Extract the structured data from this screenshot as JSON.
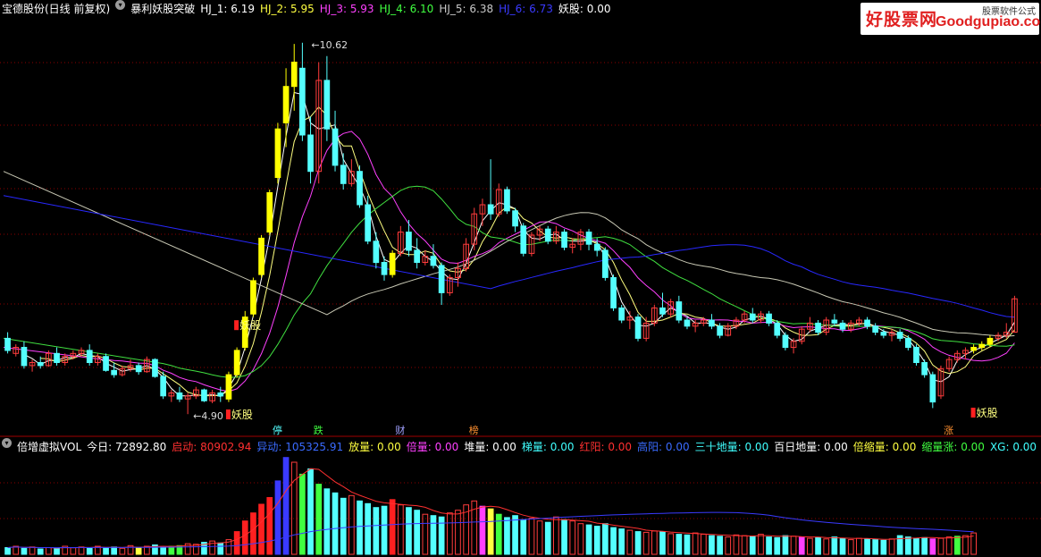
{
  "header_top": {
    "stock": "宝德股份(日线 前复权)",
    "indicator": "暴利妖股突破",
    "hj": [
      {
        "label": "HJ_1: 6.19",
        "color": "#ffffff"
      },
      {
        "label": "HJ_2: 5.95",
        "color": "#ffff40"
      },
      {
        "label": "HJ_3: 5.93",
        "color": "#ff40ff"
      },
      {
        "label": "HJ_4: 6.10",
        "color": "#40ff40"
      },
      {
        "label": "HJ_5: 6.38",
        "color": "#c8c8c8"
      },
      {
        "label": "HJ_6: 6.73",
        "color": "#3a3aff"
      }
    ],
    "yaogu": "妖股: 0.00"
  },
  "header_bottom": {
    "name": "倍增虚拟VOL",
    "items": [
      {
        "label": "今日: 72892.80",
        "color": "#ffffff"
      },
      {
        "label": "启动: 80902.94",
        "color": "#ff3030"
      },
      {
        "label": "异动: 105325.91",
        "color": "#3a6bff"
      },
      {
        "label": "放量: 0.00",
        "color": "#ffff40"
      },
      {
        "label": "倍量: 0.00",
        "color": "#ff40ff"
      },
      {
        "label": "堆量: 0.00",
        "color": "#ffffff"
      },
      {
        "label": "梯量: 0.00",
        "color": "#40ffff"
      },
      {
        "label": "红阳: 0.00",
        "color": "#ff3030"
      },
      {
        "label": "高阳: 0.00",
        "color": "#3a6bff"
      },
      {
        "label": "三十地量: 0.00",
        "color": "#40ffff"
      },
      {
        "label": "百日地量: 0.00",
        "color": "#ffffff"
      },
      {
        "label": "倍缩量: 0.00",
        "color": "#ffff40"
      },
      {
        "label": "缩量涨: 0.00",
        "color": "#40ff40"
      },
      {
        "label": "XG: 0.00",
        "color": "#40ffff"
      }
    ]
  },
  "logo": {
    "brand": "好股票网",
    "domain": "Goodgupiao.com",
    "tag": "股票软件公式"
  },
  "colors": {
    "up": "#ff3c3c",
    "down": "#54ffff",
    "signal": "#ffff00",
    "ma_white": "#ffffff",
    "ma_yellow": "#ffff80",
    "ma_magenta": "#ff40ff",
    "ma_green": "#40e040",
    "ma_gray": "#c8c8b4",
    "ma_blue": "#2828ff",
    "grid": "#8b0000"
  },
  "chart_data": {
    "type": "candlestick",
    "price_range": [
      4.4,
      11.0
    ],
    "bars": [
      {
        "o": 5.75,
        "h": 5.85,
        "l": 5.5,
        "c": 5.55
      },
      {
        "o": 5.5,
        "h": 5.65,
        "l": 5.45,
        "c": 5.6
      },
      {
        "o": 5.6,
        "h": 5.7,
        "l": 5.25,
        "c": 5.3
      },
      {
        "o": 5.3,
        "h": 5.4,
        "l": 5.2,
        "c": 5.35
      },
      {
        "o": 5.35,
        "h": 5.45,
        "l": 5.25,
        "c": 5.3
      },
      {
        "o": 5.3,
        "h": 5.55,
        "l": 5.28,
        "c": 5.5
      },
      {
        "o": 5.5,
        "h": 5.6,
        "l": 5.3,
        "c": 5.35
      },
      {
        "o": 5.35,
        "h": 5.5,
        "l": 5.3,
        "c": 5.45
      },
      {
        "o": 5.45,
        "h": 5.55,
        "l": 5.4,
        "c": 5.5
      },
      {
        "o": 5.5,
        "h": 5.6,
        "l": 5.45,
        "c": 5.55
      },
      {
        "o": 5.55,
        "h": 5.65,
        "l": 5.3,
        "c": 5.35
      },
      {
        "o": 5.35,
        "h": 5.5,
        "l": 5.3,
        "c": 5.45
      },
      {
        "o": 5.45,
        "h": 5.5,
        "l": 5.2,
        "c": 5.22
      },
      {
        "o": 5.22,
        "h": 5.35,
        "l": 5.1,
        "c": 5.15
      },
      {
        "o": 5.15,
        "h": 5.3,
        "l": 5.12,
        "c": 5.25
      },
      {
        "o": 5.25,
        "h": 5.4,
        "l": 5.2,
        "c": 5.3
      },
      {
        "o": 5.3,
        "h": 5.35,
        "l": 5.15,
        "c": 5.2
      },
      {
        "o": 5.2,
        "h": 5.45,
        "l": 5.18,
        "c": 5.4
      },
      {
        "o": 5.4,
        "h": 5.42,
        "l": 5.1,
        "c": 5.12
      },
      {
        "o": 5.12,
        "h": 5.2,
        "l": 4.75,
        "c": 4.8
      },
      {
        "o": 4.8,
        "h": 4.9,
        "l": 4.7,
        "c": 4.85
      },
      {
        "o": 4.85,
        "h": 4.95,
        "l": 4.7,
        "c": 4.75
      },
      {
        "o": 4.75,
        "h": 4.85,
        "l": 4.5,
        "c": 4.8
      },
      {
        "o": 4.8,
        "h": 4.95,
        "l": 4.75,
        "c": 4.9
      },
      {
        "o": 4.9,
        "h": 4.92,
        "l": 4.7,
        "c": 4.72
      },
      {
        "o": 4.72,
        "h": 4.9,
        "l": 4.68,
        "c": 4.85
      },
      {
        "o": 4.85,
        "h": 4.95,
        "l": 4.7,
        "c": 4.8
      },
      {
        "o": 4.75,
        "h": 5.2,
        "l": 4.7,
        "c": 5.15
      },
      {
        "o": 5.15,
        "h": 5.6,
        "l": 5.1,
        "c": 5.55
      },
      {
        "o": 5.6,
        "h": 6.2,
        "l": 5.55,
        "c": 6.1
      },
      {
        "o": 6.15,
        "h": 6.75,
        "l": 6.1,
        "c": 6.7
      },
      {
        "o": 6.8,
        "h": 7.45,
        "l": 6.75,
        "c": 7.4
      },
      {
        "o": 7.5,
        "h": 8.2,
        "l": 7.45,
        "c": 8.15
      },
      {
        "o": 8.4,
        "h": 9.3,
        "l": 8.3,
        "c": 9.2
      },
      {
        "o": 9.3,
        "h": 10.2,
        "l": 8.9,
        "c": 9.9
      },
      {
        "o": 9.9,
        "h": 10.6,
        "l": 9.5,
        "c": 10.3
      },
      {
        "o": 10.2,
        "h": 10.62,
        "l": 9.0,
        "c": 9.1
      },
      {
        "o": 9.1,
        "h": 9.4,
        "l": 8.3,
        "c": 8.5
      },
      {
        "o": 8.5,
        "h": 10.3,
        "l": 8.3,
        "c": 10.0
      },
      {
        "o": 10.0,
        "h": 10.4,
        "l": 9.0,
        "c": 9.2
      },
      {
        "o": 9.2,
        "h": 9.5,
        "l": 8.5,
        "c": 8.6
      },
      {
        "o": 8.6,
        "h": 8.8,
        "l": 8.2,
        "c": 8.3
      },
      {
        "o": 8.3,
        "h": 8.7,
        "l": 8.25,
        "c": 8.5
      },
      {
        "o": 8.5,
        "h": 8.6,
        "l": 7.9,
        "c": 7.95
      },
      {
        "o": 7.95,
        "h": 8.1,
        "l": 7.3,
        "c": 7.35
      },
      {
        "o": 7.35,
        "h": 7.5,
        "l": 6.9,
        "c": 7.0
      },
      {
        "o": 7.0,
        "h": 7.1,
        "l": 6.7,
        "c": 6.8
      },
      {
        "o": 6.8,
        "h": 7.2,
        "l": 6.75,
        "c": 7.15
      },
      {
        "o": 7.15,
        "h": 7.6,
        "l": 7.1,
        "c": 7.5
      },
      {
        "o": 7.5,
        "h": 7.7,
        "l": 7.1,
        "c": 7.2
      },
      {
        "o": 7.2,
        "h": 7.4,
        "l": 6.9,
        "c": 7.0
      },
      {
        "o": 7.0,
        "h": 7.2,
        "l": 6.95,
        "c": 7.1
      },
      {
        "o": 7.1,
        "h": 7.3,
        "l": 6.9,
        "c": 6.95
      },
      {
        "o": 6.95,
        "h": 7.0,
        "l": 6.3,
        "c": 6.5
      },
      {
        "o": 6.5,
        "h": 6.8,
        "l": 6.45,
        "c": 6.75
      },
      {
        "o": 6.75,
        "h": 7.0,
        "l": 6.6,
        "c": 6.9
      },
      {
        "o": 6.9,
        "h": 7.4,
        "l": 6.85,
        "c": 7.3
      },
      {
        "o": 7.3,
        "h": 7.9,
        "l": 7.2,
        "c": 7.8
      },
      {
        "o": 7.8,
        "h": 8.05,
        "l": 7.6,
        "c": 7.95
      },
      {
        "o": 7.95,
        "h": 8.7,
        "l": 7.7,
        "c": 7.8
      },
      {
        "o": 7.8,
        "h": 8.3,
        "l": 7.75,
        "c": 8.2
      },
      {
        "o": 8.2,
        "h": 8.25,
        "l": 7.8,
        "c": 7.85
      },
      {
        "o": 7.85,
        "h": 7.9,
        "l": 7.5,
        "c": 7.6
      },
      {
        "o": 7.6,
        "h": 7.65,
        "l": 7.1,
        "c": 7.15
      },
      {
        "o": 7.15,
        "h": 7.5,
        "l": 7.1,
        "c": 7.45
      },
      {
        "o": 7.45,
        "h": 7.6,
        "l": 7.35,
        "c": 7.55
      },
      {
        "o": 7.55,
        "h": 7.6,
        "l": 7.3,
        "c": 7.35
      },
      {
        "o": 7.35,
        "h": 7.6,
        "l": 7.3,
        "c": 7.5
      },
      {
        "o": 7.5,
        "h": 7.55,
        "l": 7.2,
        "c": 7.25
      },
      {
        "o": 7.25,
        "h": 7.4,
        "l": 7.15,
        "c": 7.3
      },
      {
        "o": 7.3,
        "h": 7.55,
        "l": 7.2,
        "c": 7.5
      },
      {
        "o": 7.5,
        "h": 7.55,
        "l": 7.2,
        "c": 7.3
      },
      {
        "o": 7.3,
        "h": 7.4,
        "l": 7.1,
        "c": 7.2
      },
      {
        "o": 7.2,
        "h": 7.25,
        "l": 6.7,
        "c": 6.75
      },
      {
        "o": 6.75,
        "h": 6.8,
        "l": 6.2,
        "c": 6.25
      },
      {
        "o": 6.25,
        "h": 6.3,
        "l": 6.0,
        "c": 6.05
      },
      {
        "o": 6.05,
        "h": 6.2,
        "l": 5.9,
        "c": 6.1
      },
      {
        "o": 6.1,
        "h": 6.15,
        "l": 5.7,
        "c": 5.75
      },
      {
        "o": 5.75,
        "h": 6.1,
        "l": 5.7,
        "c": 6.0
      },
      {
        "o": 6.0,
        "h": 6.3,
        "l": 5.95,
        "c": 6.25
      },
      {
        "o": 6.25,
        "h": 6.5,
        "l": 6.1,
        "c": 6.15
      },
      {
        "o": 6.15,
        "h": 6.4,
        "l": 6.1,
        "c": 6.35
      },
      {
        "o": 6.35,
        "h": 6.45,
        "l": 6.0,
        "c": 6.05
      },
      {
        "o": 6.05,
        "h": 6.1,
        "l": 5.9,
        "c": 5.95
      },
      {
        "o": 5.95,
        "h": 6.05,
        "l": 5.85,
        "c": 6.0
      },
      {
        "o": 6.0,
        "h": 6.1,
        "l": 5.95,
        "c": 6.05
      },
      {
        "o": 6.05,
        "h": 6.15,
        "l": 5.9,
        "c": 5.95
      },
      {
        "o": 5.95,
        "h": 6.0,
        "l": 5.75,
        "c": 5.8
      },
      {
        "o": 5.8,
        "h": 6.0,
        "l": 5.78,
        "c": 5.95
      },
      {
        "o": 5.95,
        "h": 6.1,
        "l": 5.9,
        "c": 6.05
      },
      {
        "o": 6.05,
        "h": 6.2,
        "l": 6.0,
        "c": 6.15
      },
      {
        "o": 6.15,
        "h": 6.25,
        "l": 6.0,
        "c": 6.05
      },
      {
        "o": 6.05,
        "h": 6.2,
        "l": 6.0,
        "c": 6.15
      },
      {
        "o": 6.15,
        "h": 6.2,
        "l": 5.95,
        "c": 6.0
      },
      {
        "o": 6.0,
        "h": 6.05,
        "l": 5.75,
        "c": 5.8
      },
      {
        "o": 5.8,
        "h": 5.85,
        "l": 5.55,
        "c": 5.6
      },
      {
        "o": 5.6,
        "h": 5.75,
        "l": 5.5,
        "c": 5.7
      },
      {
        "o": 5.7,
        "h": 5.95,
        "l": 5.65,
        "c": 5.9
      },
      {
        "o": 5.9,
        "h": 6.1,
        "l": 5.85,
        "c": 6.0
      },
      {
        "o": 6.0,
        "h": 6.05,
        "l": 5.8,
        "c": 5.85
      },
      {
        "o": 5.85,
        "h": 6.1,
        "l": 5.8,
        "c": 6.05
      },
      {
        "o": 6.05,
        "h": 6.15,
        "l": 5.95,
        "c": 6.0
      },
      {
        "o": 6.0,
        "h": 6.05,
        "l": 5.85,
        "c": 5.9
      },
      {
        "o": 5.9,
        "h": 6.05,
        "l": 5.85,
        "c": 6.0
      },
      {
        "o": 6.0,
        "h": 6.1,
        "l": 5.95,
        "c": 6.05
      },
      {
        "o": 6.05,
        "h": 6.1,
        "l": 5.9,
        "c": 5.95
      },
      {
        "o": 5.95,
        "h": 6.0,
        "l": 5.8,
        "c": 5.85
      },
      {
        "o": 5.85,
        "h": 5.9,
        "l": 5.75,
        "c": 5.8
      },
      {
        "o": 5.8,
        "h": 5.9,
        "l": 5.7,
        "c": 5.85
      },
      {
        "o": 5.85,
        "h": 5.9,
        "l": 5.7,
        "c": 5.75
      },
      {
        "o": 5.75,
        "h": 5.8,
        "l": 5.55,
        "c": 5.6
      },
      {
        "o": 5.6,
        "h": 5.65,
        "l": 5.3,
        "c": 5.35
      },
      {
        "o": 5.35,
        "h": 5.4,
        "l": 5.1,
        "c": 5.15
      },
      {
        "o": 5.15,
        "h": 5.2,
        "l": 4.6,
        "c": 4.7
      },
      {
        "o": 4.8,
        "h": 5.3,
        "l": 4.75,
        "c": 5.25
      },
      {
        "o": 5.25,
        "h": 5.45,
        "l": 5.2,
        "c": 5.4
      },
      {
        "o": 5.4,
        "h": 5.55,
        "l": 5.35,
        "c": 5.5
      },
      {
        "o": 5.5,
        "h": 5.6,
        "l": 5.4,
        "c": 5.55
      },
      {
        "o": 5.55,
        "h": 5.65,
        "l": 5.5,
        "c": 5.6
      },
      {
        "o": 5.6,
        "h": 5.7,
        "l": 5.55,
        "c": 5.65
      },
      {
        "o": 5.65,
        "h": 5.8,
        "l": 5.6,
        "c": 5.75
      },
      {
        "o": 5.75,
        "h": 5.85,
        "l": 5.7,
        "c": 5.8
      },
      {
        "o": 5.8,
        "h": 6.0,
        "l": 5.75,
        "c": 5.85
      },
      {
        "o": 5.85,
        "h": 6.45,
        "l": 5.85,
        "c": 6.4
      }
    ],
    "signal_up": [
      27,
      28,
      29,
      30,
      31,
      32,
      33,
      34,
      35,
      47,
      118,
      119,
      120
    ],
    "signal_down": [],
    "volume": [
      10,
      12,
      9,
      11,
      8,
      10,
      9,
      12,
      10,
      11,
      9,
      12,
      10,
      11,
      9,
      13,
      10,
      12,
      14,
      11,
      12,
      13,
      16,
      15,
      18,
      20,
      17,
      22,
      34,
      50,
      62,
      75,
      85,
      110,
      145,
      138,
      120,
      128,
      105,
      98,
      92,
      84,
      88,
      80,
      76,
      70,
      72,
      82,
      74,
      70,
      66,
      60,
      58,
      56,
      62,
      66,
      74,
      80,
      72,
      68,
      60,
      55,
      58,
      52,
      54,
      50,
      48,
      56,
      52,
      50,
      46,
      44,
      42,
      46,
      40,
      38,
      36,
      34,
      33,
      35,
      34,
      31,
      30,
      29,
      32,
      30,
      28,
      27,
      26,
      29,
      28,
      27,
      30,
      26,
      25,
      28,
      27,
      26,
      24,
      25,
      23,
      26,
      24,
      22,
      24,
      23,
      22,
      21,
      23,
      28,
      26,
      24,
      25,
      23,
      24,
      26,
      27,
      28,
      32
    ],
    "volume_colors": {
      "28": "#ff2020",
      "29": "#ff2020",
      "30": "#ff2020",
      "31": "#ff2020",
      "32": "#ff2020",
      "33": "#3a3aff",
      "34": "#3a3aff",
      "36": "#40ff40",
      "47": "#ff2020",
      "58": "#ff40ff",
      "59": "#ffff40",
      "97": "#ff40ff",
      "113": "#ff40ff",
      "116": "#40ff40",
      "38": "#40ff40",
      "60": "#40ff40",
      "16": "#ffff40",
      "20": "#40ff40",
      "21": "#40ff40"
    },
    "volume_range": [
      0,
      150
    ],
    "annotations": {
      "high": "10.62",
      "low": "4.90",
      "tags": [
        {
          "text": "妖股",
          "color": "#ffff80"
        },
        {
          "text": "妖股",
          "color": "#ffff80"
        },
        {
          "text": "妖股",
          "color": "#ffff80"
        }
      ],
      "markers": [
        {
          "text": "停",
          "color": "#54ffff"
        },
        {
          "text": "跌",
          "color": "#40ff40"
        },
        {
          "text": "财",
          "color": "#a0a0ff"
        },
        {
          "text": "榜",
          "color": "#ff9030"
        },
        {
          "text": "涨",
          "color": "#ff9030"
        }
      ]
    }
  }
}
